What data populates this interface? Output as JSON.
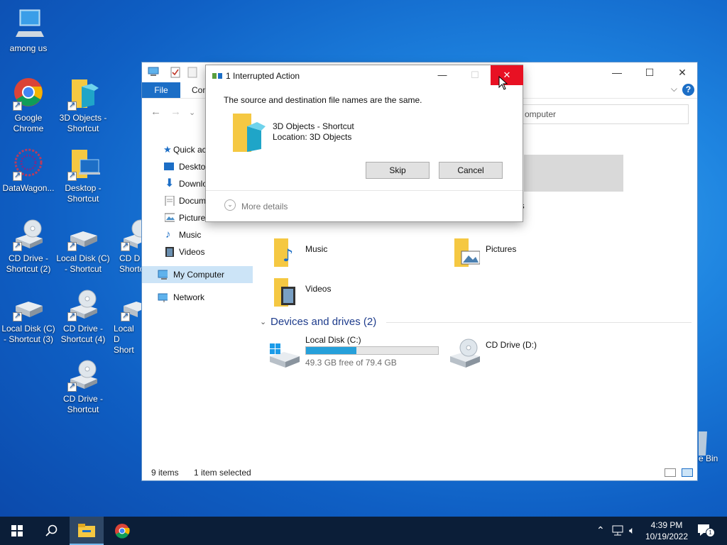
{
  "desktop": {
    "icons": [
      {
        "label": "among us"
      },
      {
        "label": "Google Chrome"
      },
      {
        "label": "3D Objects - Shortcut"
      },
      {
        "label": "DataWagon..."
      },
      {
        "label": "Desktop - Shortcut"
      },
      {
        "label": "CD Drive - Shortcut (2)"
      },
      {
        "label": "Local Disk (C) - Shortcut"
      },
      {
        "label": "CD D Shortc"
      },
      {
        "label": "Local Disk (C) - Shortcut (3)"
      },
      {
        "label": "CD Drive - Shortcut (4)"
      },
      {
        "label": "Local D Short"
      },
      {
        "label": "CD Drive - Shortcut"
      },
      {
        "label": "e Bin"
      }
    ]
  },
  "explorer": {
    "ribbon": {
      "file_tab": "File",
      "tab2": "Com"
    },
    "address_text": "omputer",
    "nav": [
      {
        "label": "Quick ac",
        "icon": "star-icon"
      },
      {
        "label": "Deskto",
        "icon": "desktop-icon"
      },
      {
        "label": "Downlo",
        "icon": "download-icon"
      },
      {
        "label": "Docum",
        "icon": "document-icon"
      },
      {
        "label": "Picture",
        "icon": "picture-icon"
      },
      {
        "label": "Music",
        "icon": "music-icon"
      },
      {
        "label": "Videos",
        "icon": "video-icon"
      },
      {
        "label": "My Computer",
        "icon": "computer-icon"
      },
      {
        "label": "Network",
        "icon": "network-icon"
      }
    ],
    "folders": [
      {
        "label": "ls"
      },
      {
        "label": "Music"
      },
      {
        "label": "Pictures"
      },
      {
        "label": "Videos"
      }
    ],
    "devices_header": "Devices and drives (2)",
    "drives": [
      {
        "label": "Local Disk (C:)",
        "free": "49.3 GB free of 79.4 GB",
        "used_fraction": 0.38
      },
      {
        "label": "CD Drive (D:)"
      }
    ],
    "status": {
      "items": "9 items",
      "selected": "1 item selected"
    }
  },
  "dialog": {
    "title": "1 Interrupted Action",
    "message": "The source and destination file names are the same.",
    "file_name": "3D Objects - Shortcut",
    "location": "Location: 3D Objects",
    "skip": "Skip",
    "cancel": "Cancel",
    "more_details": "More details"
  },
  "taskbar": {
    "time": "4:39 PM",
    "date": "10/19/2022",
    "notification_count": "1"
  },
  "colors": {
    "accent": "#1c6ec6",
    "close_red": "#e81123",
    "taskbar": "#0b1e38"
  }
}
